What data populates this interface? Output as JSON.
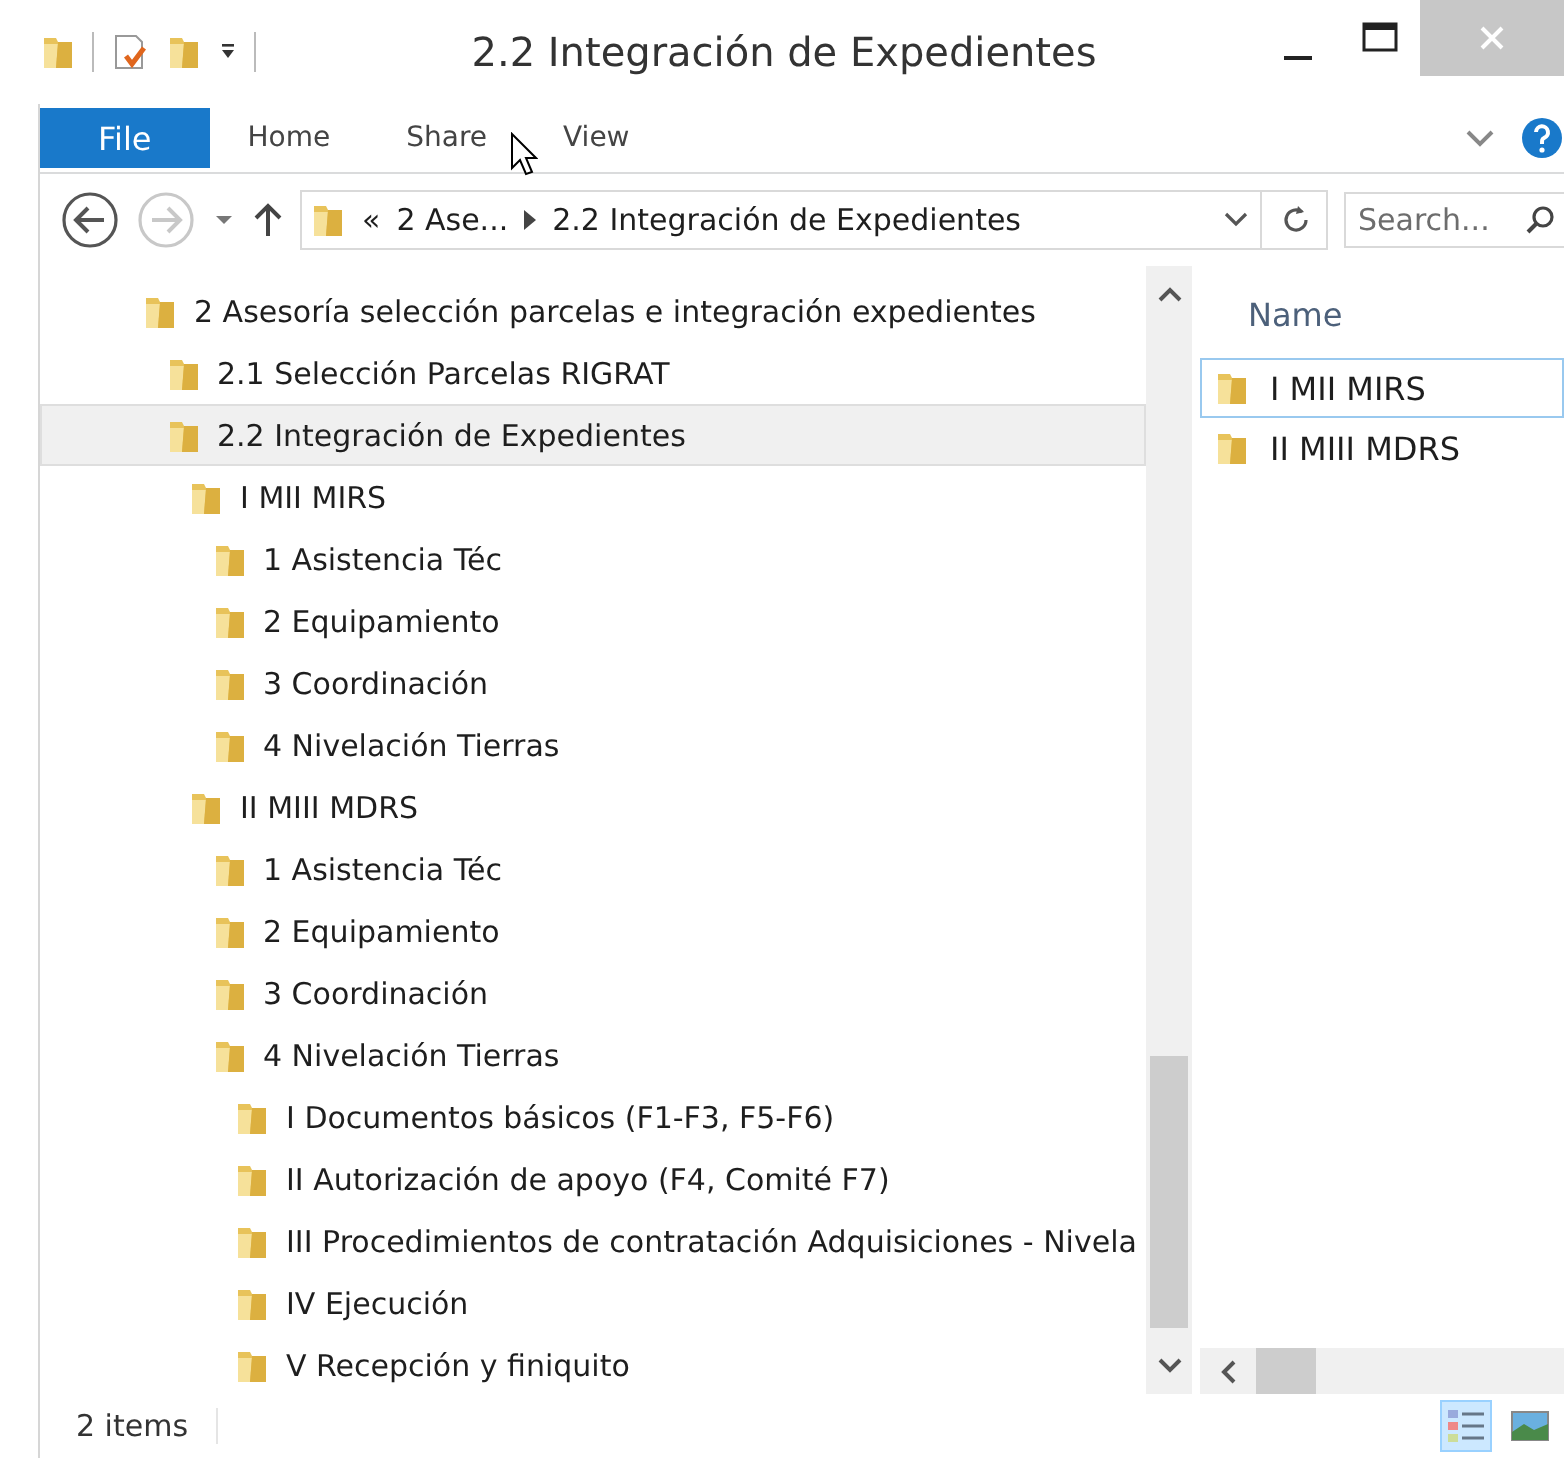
{
  "window": {
    "title": "2.2 Integración de Expedientes"
  },
  "ribbon": {
    "tabs": [
      {
        "label": "File",
        "kind": "file",
        "selected": false
      },
      {
        "label": "Home",
        "kind": "tab",
        "selected": false
      },
      {
        "label": "Share",
        "kind": "tab",
        "selected": false
      },
      {
        "label": "View",
        "kind": "tab",
        "selected": false
      }
    ]
  },
  "address_bar": {
    "overflow": "«",
    "crumbs": [
      "2 Ase...",
      "2.2 Integración de Expedientes"
    ]
  },
  "search": {
    "placeholder": "Search..."
  },
  "tree": [
    {
      "label": "2 Asesoría selección parcelas e integración expedientes",
      "selected": false,
      "children": [
        {
          "label": "2.1 Selección Parcelas RIGRAT",
          "selected": false
        },
        {
          "label": "2.2 Integración de Expedientes",
          "selected": true,
          "children": [
            {
              "label": "I MII MIRS",
              "selected": false,
              "children": [
                {
                  "label": "1 Asistencia Téc",
                  "selected": false
                },
                {
                  "label": "2 Equipamiento",
                  "selected": false
                },
                {
                  "label": "3 Coordinación",
                  "selected": false
                },
                {
                  "label": "4 Nivelación Tierras",
                  "selected": false
                }
              ]
            },
            {
              "label": "II MIII MDRS",
              "selected": false,
              "children": [
                {
                  "label": "1 Asistencia Téc",
                  "selected": false
                },
                {
                  "label": "2 Equipamiento",
                  "selected": false
                },
                {
                  "label": "3 Coordinación",
                  "selected": false
                },
                {
                  "label": "4 Nivelación Tierras",
                  "selected": false,
                  "children": [
                    {
                      "label": "I Documentos básicos (F1-F3, F5-F6)",
                      "selected": false
                    },
                    {
                      "label": "II Autorización de apoyo (F4, Comité F7)",
                      "selected": false
                    },
                    {
                      "label": "III Procedimientos de contratación Adquisiciones - Nivela",
                      "selected": false
                    },
                    {
                      "label": "IV Ejecución",
                      "selected": false
                    },
                    {
                      "label": "V Recepción y finiquito",
                      "selected": false
                    }
                  ]
                }
              ]
            }
          ]
        }
      ]
    }
  ],
  "content": {
    "column": "Name",
    "files": [
      {
        "name": "I MII MIRS",
        "selected": true
      },
      {
        "name": "II MIII MDRS",
        "selected": false
      }
    ]
  },
  "status_bar": {
    "count": "2 items",
    "views": [
      {
        "kind": "details",
        "selected": true
      },
      {
        "kind": "thumbnails",
        "selected": false
      }
    ]
  }
}
